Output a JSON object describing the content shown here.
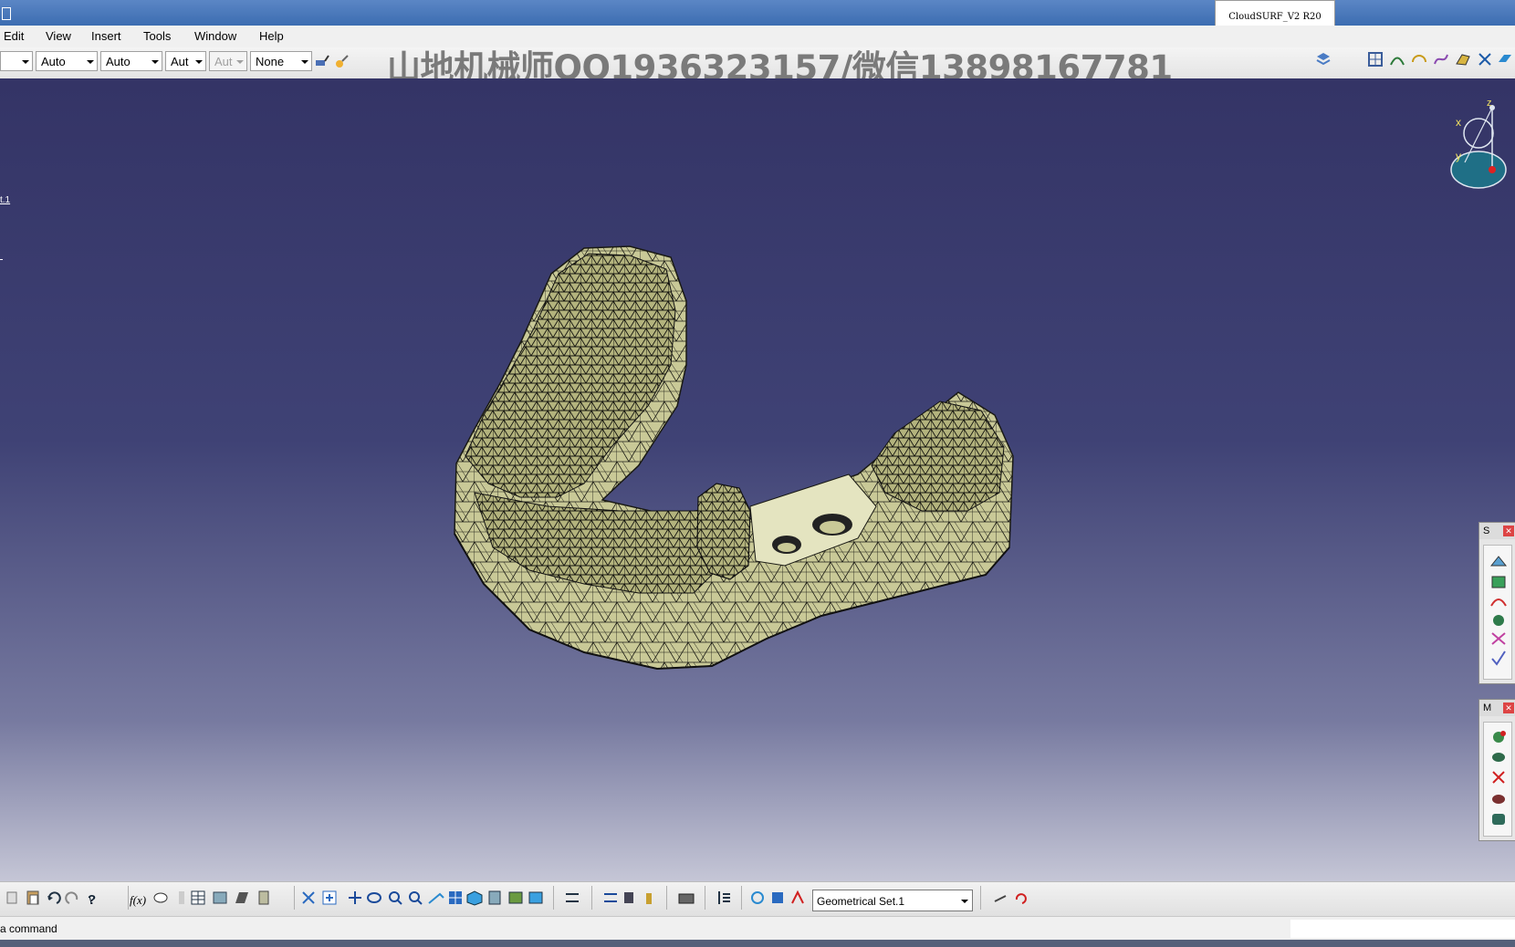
{
  "window": {
    "cloudsurf_tab": "CloudSURF_V2 R20"
  },
  "menu": {
    "items": [
      "Edit",
      "View",
      "Insert",
      "Tools",
      "Window",
      "Help"
    ]
  },
  "toolbar_top": {
    "combos": [
      "Auto",
      "Auto",
      "Aut",
      "Aut",
      "None"
    ],
    "watermark": "山地机械师QQ1936323157/微信13898167781"
  },
  "tree": {
    "fragment": "t.1"
  },
  "compass": {
    "x_label": "x",
    "y_label": "y",
    "z_label": "z"
  },
  "side_panels": {
    "upper_title": "S",
    "lower_title": "M"
  },
  "toolbar_bottom": {
    "geometrical_set": "Geometrical Set.1"
  },
  "status": {
    "prompt": "a command"
  },
  "colors": {
    "mesh_fill": "#c9c997",
    "mesh_line": "#1a1a14",
    "viewport_top": "#343466",
    "viewport_bottom": "#c5c6d6"
  }
}
